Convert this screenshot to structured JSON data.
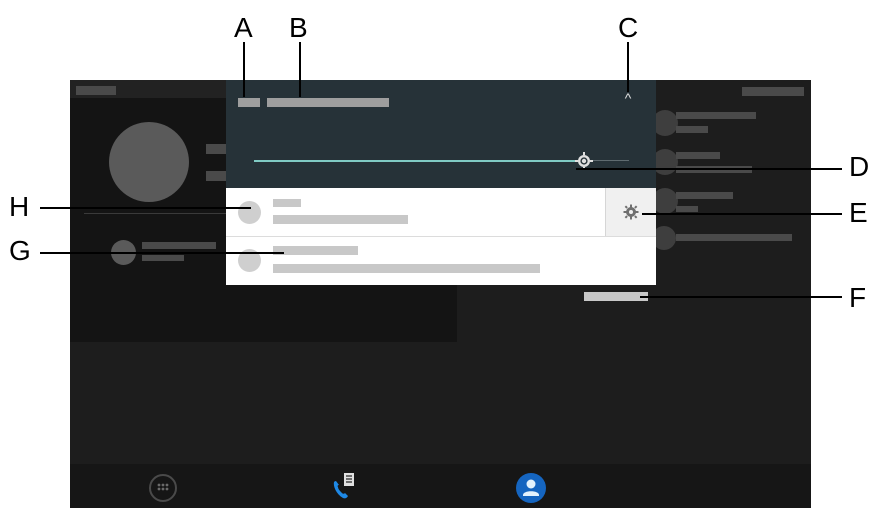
{
  "callouts": {
    "a": "A",
    "b": "B",
    "c": "C",
    "d": "D",
    "e": "E",
    "f": "F",
    "g": "G",
    "h": "H"
  },
  "panel": {
    "collapse_glyph": "^",
    "brightness_level": 0.88
  },
  "icons": {
    "dialpad": "dialpad-icon",
    "calls": "phone-log-icon",
    "contacts": "person-icon",
    "settings": "gear-icon",
    "brightness": "brightness-icon"
  },
  "colors": {
    "device_bg": "#1d1d1d",
    "panel_bg": "#263238",
    "slider_track": "#80cbc4",
    "accent_blue": "#1565c0",
    "placeholder_light": "#c8c8c8"
  }
}
